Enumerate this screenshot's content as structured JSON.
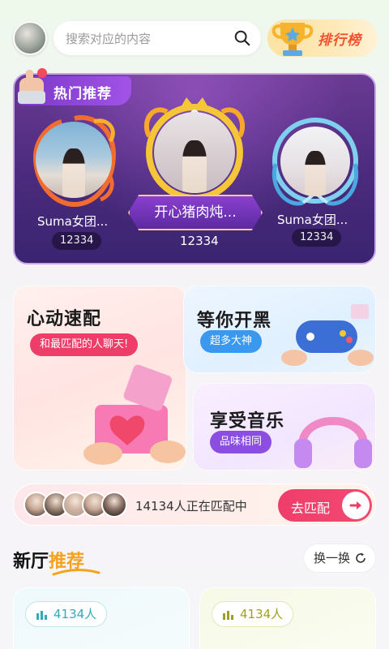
{
  "header": {
    "search_placeholder": "搜索对应的内容",
    "rank_label": "排行榜"
  },
  "hot": {
    "tag": "热门推荐",
    "candidates": [
      {
        "name": "Suma女团...",
        "score": "12334"
      },
      {
        "name": "开心猪肉炖...",
        "score": "12334"
      },
      {
        "name": "Suma女团...",
        "score": "12334"
      }
    ]
  },
  "features": {
    "match": {
      "title": "心动速配",
      "pill": "和最匹配的人聊天!"
    },
    "game": {
      "title": "等你开黑",
      "pill": "超多大神"
    },
    "music": {
      "title": "享受音乐",
      "pill": "品味相同"
    }
  },
  "matching": {
    "text": "14134人正在匹配中",
    "button": "去匹配"
  },
  "section": {
    "title_a": "新厅",
    "title_b": "推荐",
    "swap": "换一换"
  },
  "rooms": [
    {
      "count": "4134人",
      "accent": "#33aabb"
    },
    {
      "count": "4134人",
      "accent": "#a0a020"
    }
  ],
  "colors": {
    "pink": "#ef3d6a",
    "blue": "#3a98ee",
    "purple": "#8b4ee0",
    "gold": "#f5a21d"
  }
}
